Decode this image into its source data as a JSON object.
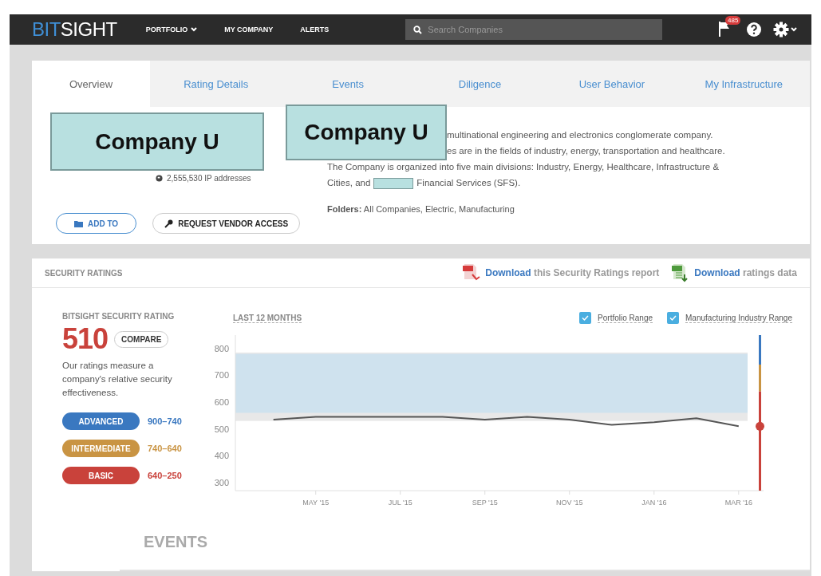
{
  "nav": {
    "logo": {
      "accent": "BIT",
      "rest": "SIGHT"
    },
    "menu": [
      {
        "label": "PORTFOLIO",
        "dropdown": true
      },
      {
        "label": "MY COMPANY",
        "dropdown": false
      },
      {
        "label": "ALERTS",
        "dropdown": false
      }
    ],
    "search": {
      "placeholder": "Search Companies"
    },
    "alerts_badge": "485"
  },
  "tabs": [
    {
      "label": "Overview",
      "selected": true
    },
    {
      "label": "Rating Details",
      "selected": false
    },
    {
      "label": "Events",
      "selected": false
    },
    {
      "label": "Diligence",
      "selected": false
    },
    {
      "label": "User Behavior",
      "selected": false
    },
    {
      "label": "My Infrastructure",
      "selected": false
    }
  ],
  "company": {
    "name_labels": [
      "Company U",
      "Company U"
    ],
    "ip_addresses": "2,555,530 IP addresses",
    "description_lines": [
      "multinational engineering and electronics conglomerate company.",
      "es are in the fields of industry, energy, transportation and healthcare.",
      "The Company is organized into five main divisions: Industry, Energy, Healthcare, Infrastructure &"
    ],
    "description_last": {
      "before": "Cities, and",
      "after": "Financial Services (SFS)."
    },
    "folders_label": "Folders:",
    "folders": "All Companies, Electric, Manufacturing",
    "buttons": [
      "ADD TO",
      "REQUEST VENDOR ACCESS"
    ]
  },
  "ratings": {
    "title": "SECURITY RATINGS",
    "downloads": [
      {
        "kind": "pdf",
        "link": "Download",
        "text": "this Security Ratings report"
      },
      {
        "kind": "csv",
        "link": "Download",
        "text": "ratings data"
      }
    ],
    "rating_label": "BITSIGHT SECURITY RATING",
    "rating": "510",
    "compare": "COMPARE",
    "explanation": "Our ratings measure a company's relative security effectiveness.",
    "tiers": [
      {
        "name": "ADVANCED",
        "range": "900–740",
        "color": "#3a78c0"
      },
      {
        "name": "INTERMEDIATE",
        "range": "740–640",
        "color": "#c99443"
      },
      {
        "name": "BASIC",
        "range": "640–250",
        "color": "#c9423b"
      }
    ],
    "period": "LAST 12 MONTHS",
    "legend": [
      {
        "label": "Portfolio Range",
        "checked": true
      },
      {
        "label": "Manufacturing Industry Range",
        "checked": true
      }
    ],
    "chart_data": {
      "type": "line",
      "categories": [
        null,
        "MAY '15",
        null,
        "JUL '15",
        null,
        "SEP '15",
        null,
        "NOV '15",
        null,
        "JAN '16",
        null,
        "MAR '16"
      ],
      "series": [
        {
          "color": "#555555",
          "values": [
            535,
            545,
            545,
            545,
            545,
            535,
            545,
            535,
            515,
            525,
            540,
            510
          ]
        }
      ],
      "bands": [
        {
          "axis": "y",
          "from": 560,
          "to": 780,
          "color": "#cfe2ee"
        },
        {
          "axis": "y",
          "from": 530,
          "to": 785,
          "color": "#e8e8e8"
        }
      ],
      "ylim": [
        270,
        850
      ],
      "yticks": [
        300,
        400,
        500,
        600,
        700,
        800
      ]
    }
  },
  "events": {
    "title": "EVENTS"
  }
}
